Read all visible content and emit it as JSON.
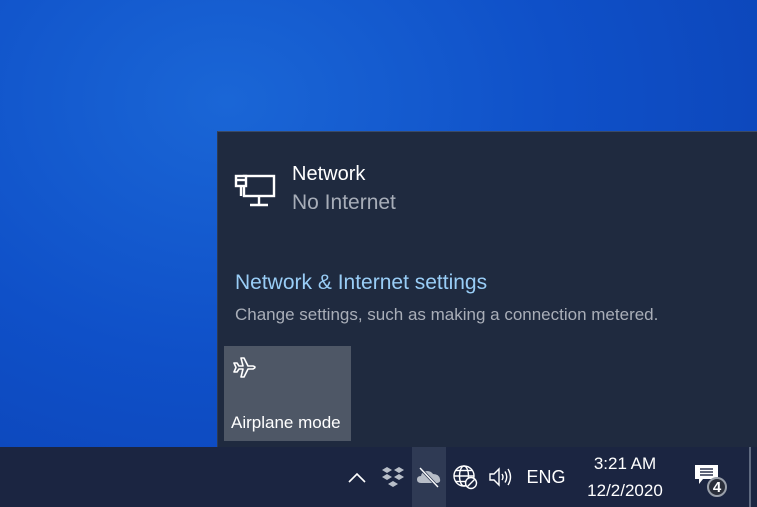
{
  "network": {
    "name": "Network",
    "status": "No Internet",
    "icon": "wired-network-icon"
  },
  "settings": {
    "link_label": "Network & Internet settings",
    "description": "Change settings, such as making a connection metered."
  },
  "quick_actions": [
    {
      "label": "Airplane mode",
      "icon": "airplane-icon",
      "active": false
    }
  ],
  "taskbar": {
    "tray_icons": [
      {
        "name": "show-hidden-icons",
        "icon": "chevron-up-icon"
      },
      {
        "name": "dropbox",
        "icon": "dropbox-icon"
      },
      {
        "name": "onedrive",
        "icon": "cloud-off-icon"
      },
      {
        "name": "network",
        "icon": "globe-blocked-icon"
      },
      {
        "name": "volume",
        "icon": "speaker-icon"
      }
    ],
    "language": "ENG",
    "time": "3:21 AM",
    "date": "12/2/2020",
    "notifications_count": "4"
  },
  "colors": {
    "flyout_bg": "#1f2a3f",
    "link": "#99cdf6",
    "tile_bg": "#4e5766",
    "taskbar_bg": "#1b2541"
  }
}
